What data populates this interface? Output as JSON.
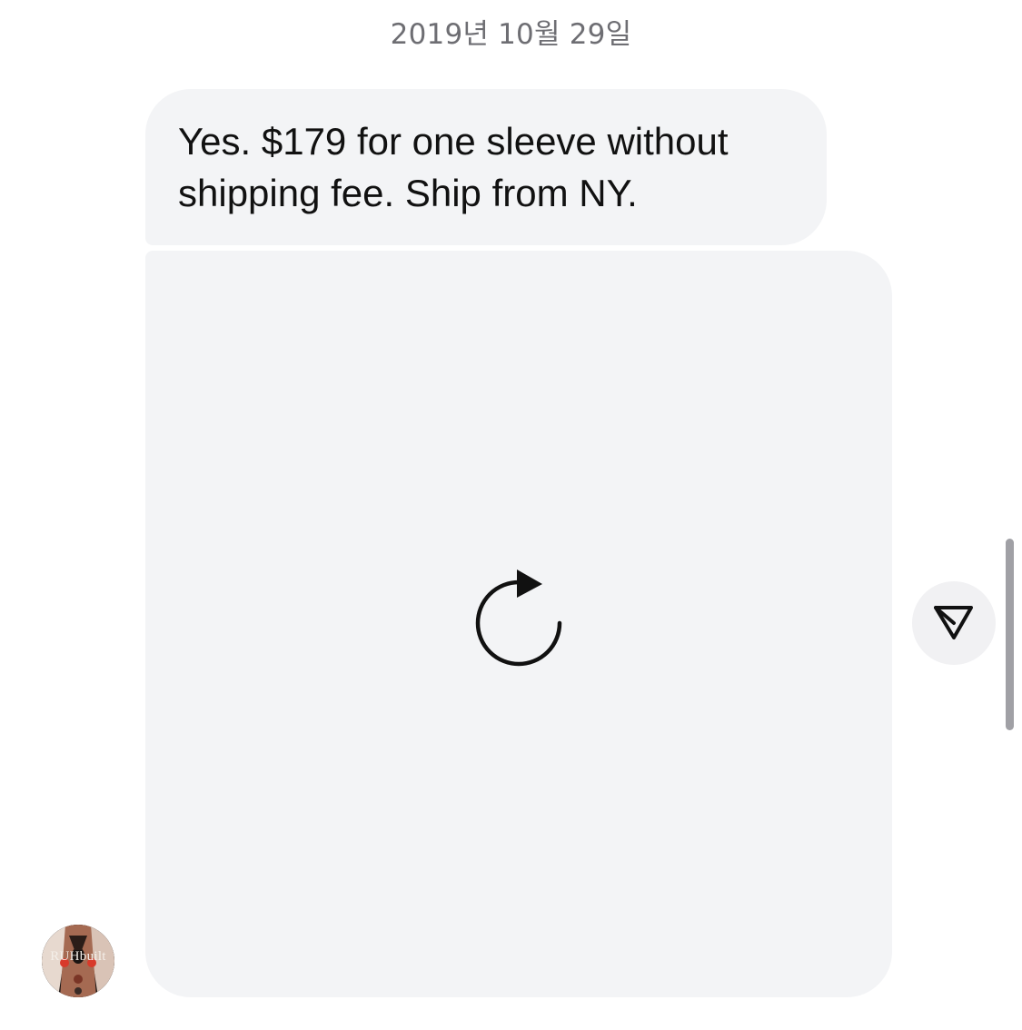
{
  "date_header": "2019년 10월 29일",
  "messages": [
    {
      "type": "text",
      "text": "Yes. $179 for one sleeve without shipping fee. Ship from NY."
    },
    {
      "type": "media",
      "state": "failed-to-load",
      "icon": "retry-icon"
    }
  ],
  "share_button": {
    "icon": "send-icon"
  },
  "avatar": {
    "label": "RUHbuilt"
  },
  "colors": {
    "bubble_background": "#f3f4f6",
    "date_text": "#6e6e73",
    "message_text": "#111111"
  }
}
